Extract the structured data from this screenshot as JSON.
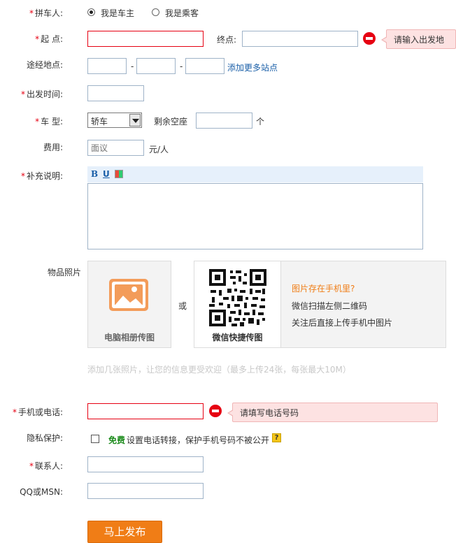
{
  "poster": {
    "label": "拼车人:",
    "options": [
      "我是车主",
      "我是乘客"
    ],
    "selected_index": 0
  },
  "route": {
    "start_label": "起  点:",
    "end_label": "终点:",
    "error_tip": "请输入出发地"
  },
  "via": {
    "label": "途经地点:",
    "separator": "-",
    "add_more": "添加更多站点"
  },
  "depart_time": {
    "label": "出发时间:"
  },
  "car": {
    "label": "车  型:",
    "type_value": "轿车",
    "seats_label": "剩余空座",
    "seats_unit": "个"
  },
  "fee": {
    "label": "费用:",
    "placeholder": "面议",
    "unit": "元/人"
  },
  "notes": {
    "label": "补充说明:",
    "bold": "B",
    "underline": "U"
  },
  "photos": {
    "label": "物品照片",
    "pc_upload": "电脑相册传图",
    "or": "或",
    "wechat_upload": "微信快捷传图",
    "phone_title": "图片存在手机里?",
    "phone_line1": "微信扫描左侧二维码",
    "phone_line2": "关注后直接上传手机中图片",
    "hint": "添加几张照片，让您的信息更受欢迎（最多上传24张，每张最大10M）"
  },
  "phone": {
    "label": "手机或电话:",
    "error_tip": "请填写电话号码"
  },
  "privacy": {
    "label": "隐私保护:",
    "free": "免费",
    "text": "设置电话转接，保护手机号码不被公开",
    "help": "?"
  },
  "contact": {
    "label": "联系人:"
  },
  "im": {
    "label": "QQ或MSN:"
  },
  "submit": {
    "label": "马上发布"
  },
  "colors": {
    "required": "#e60012",
    "link": "#1a5fa8",
    "accent": "#f07d16",
    "free": "#1a8a1a",
    "tip_bg": "#fde2e2"
  }
}
